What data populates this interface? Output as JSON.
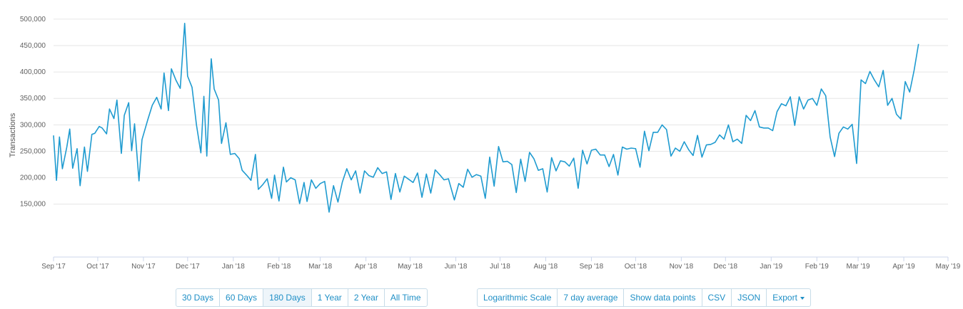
{
  "chart_data": {
    "type": "line",
    "ylabel": "Transactions",
    "ylim": [
      50000,
      520000
    ],
    "y_ticks": [
      150000,
      200000,
      250000,
      300000,
      350000,
      400000,
      450000,
      500000
    ],
    "y_tick_labels": [
      "150,000",
      "200,000",
      "250,000",
      "300,000",
      "350,000",
      "400,000",
      "450,000",
      "500,000"
    ],
    "x_ticks": [
      {
        "label": "Sep '17",
        "date": "2017-09-01"
      },
      {
        "label": "Oct '17",
        "date": "2017-10-01"
      },
      {
        "label": "Nov '17",
        "date": "2017-11-01"
      },
      {
        "label": "Dec '17",
        "date": "2017-12-01"
      },
      {
        "label": "Jan '18",
        "date": "2018-01-01"
      },
      {
        "label": "Feb '18",
        "date": "2018-02-01"
      },
      {
        "label": "Mar '18",
        "date": "2018-03-01"
      },
      {
        "label": "Apr '18",
        "date": "2018-04-01"
      },
      {
        "label": "May '18",
        "date": "2018-05-01"
      },
      {
        "label": "Jun '18",
        "date": "2018-06-01"
      },
      {
        "label": "Jul '18",
        "date": "2018-07-01"
      },
      {
        "label": "Aug '18",
        "date": "2018-08-01"
      },
      {
        "label": "Sep '18",
        "date": "2018-09-01"
      },
      {
        "label": "Oct '18",
        "date": "2018-10-01"
      },
      {
        "label": "Nov '18",
        "date": "2018-11-01"
      },
      {
        "label": "Dec '18",
        "date": "2018-12-01"
      },
      {
        "label": "Jan '19",
        "date": "2019-01-01"
      },
      {
        "label": "Feb '19",
        "date": "2019-02-01"
      },
      {
        "label": "Mar '19",
        "date": "2019-03-01"
      },
      {
        "label": "Apr '19",
        "date": "2019-04-01"
      },
      {
        "label": "May '19",
        "date": "2019-05-01"
      }
    ],
    "grid": true,
    "line_color": "#1f9bd0",
    "series": [
      {
        "points": [
          [
            "2017-09-01",
            280000
          ],
          [
            "2017-09-03",
            195000
          ],
          [
            "2017-09-05",
            277000
          ],
          [
            "2017-09-07",
            217000
          ],
          [
            "2017-09-10",
            258000
          ],
          [
            "2017-09-12",
            292000
          ],
          [
            "2017-09-14",
            218000
          ],
          [
            "2017-09-17",
            255000
          ],
          [
            "2017-09-19",
            185000
          ],
          [
            "2017-09-22",
            258000
          ],
          [
            "2017-09-24",
            212000
          ],
          [
            "2017-09-27",
            282000
          ],
          [
            "2017-09-29",
            284000
          ],
          [
            "2017-10-02",
            297000
          ],
          [
            "2017-10-04",
            294000
          ],
          [
            "2017-10-07",
            283000
          ],
          [
            "2017-10-09",
            330000
          ],
          [
            "2017-10-12",
            312000
          ],
          [
            "2017-10-14",
            347000
          ],
          [
            "2017-10-17",
            246000
          ],
          [
            "2017-10-19",
            318000
          ],
          [
            "2017-10-22",
            342000
          ],
          [
            "2017-10-24",
            251000
          ],
          [
            "2017-10-26",
            302000
          ],
          [
            "2017-10-29",
            194000
          ],
          [
            "2017-10-31",
            272000
          ],
          [
            "2017-11-04",
            310000
          ],
          [
            "2017-11-07",
            337000
          ],
          [
            "2017-11-10",
            352000
          ],
          [
            "2017-11-13",
            330000
          ],
          [
            "2017-11-15",
            398000
          ],
          [
            "2017-11-18",
            327000
          ],
          [
            "2017-11-20",
            406000
          ],
          [
            "2017-11-23",
            385000
          ],
          [
            "2017-11-26",
            369000
          ],
          [
            "2017-11-29",
            492000
          ],
          [
            "2017-12-01",
            392000
          ],
          [
            "2017-12-04",
            371000
          ],
          [
            "2017-12-07",
            300000
          ],
          [
            "2017-12-10",
            247000
          ],
          [
            "2017-12-12",
            354000
          ],
          [
            "2017-12-14",
            241000
          ],
          [
            "2017-12-17",
            425000
          ],
          [
            "2017-12-19",
            368000
          ],
          [
            "2017-12-22",
            347000
          ],
          [
            "2017-12-24",
            265000
          ],
          [
            "2017-12-27",
            304000
          ],
          [
            "2017-12-30",
            244000
          ],
          [
            "2018-01-02",
            246000
          ],
          [
            "2018-01-05",
            236000
          ],
          [
            "2018-01-07",
            214000
          ],
          [
            "2018-01-10",
            205000
          ],
          [
            "2018-01-13",
            195000
          ],
          [
            "2018-01-16",
            244000
          ],
          [
            "2018-01-18",
            178000
          ],
          [
            "2018-01-21",
            187000
          ],
          [
            "2018-01-24",
            198000
          ],
          [
            "2018-01-27",
            161000
          ],
          [
            "2018-01-29",
            205000
          ],
          [
            "2018-02-01",
            156000
          ],
          [
            "2018-02-04",
            220000
          ],
          [
            "2018-02-06",
            192000
          ],
          [
            "2018-02-09",
            200000
          ],
          [
            "2018-02-12",
            196000
          ],
          [
            "2018-02-15",
            151000
          ],
          [
            "2018-02-18",
            191000
          ],
          [
            "2018-02-20",
            155000
          ],
          [
            "2018-02-23",
            196000
          ],
          [
            "2018-02-26",
            180000
          ],
          [
            "2018-03-01",
            189000
          ],
          [
            "2018-03-04",
            193000
          ],
          [
            "2018-03-07",
            135000
          ],
          [
            "2018-03-10",
            185000
          ],
          [
            "2018-03-13",
            154000
          ],
          [
            "2018-03-16",
            192000
          ],
          [
            "2018-03-19",
            217000
          ],
          [
            "2018-03-22",
            196000
          ],
          [
            "2018-03-25",
            213000
          ],
          [
            "2018-03-28",
            171000
          ],
          [
            "2018-03-31",
            213000
          ],
          [
            "2018-04-03",
            204000
          ],
          [
            "2018-04-06",
            201000
          ],
          [
            "2018-04-09",
            219000
          ],
          [
            "2018-04-12",
            208000
          ],
          [
            "2018-04-15",
            211000
          ],
          [
            "2018-04-18",
            159000
          ],
          [
            "2018-04-21",
            208000
          ],
          [
            "2018-04-24",
            173000
          ],
          [
            "2018-04-27",
            203000
          ],
          [
            "2018-04-30",
            197000
          ],
          [
            "2018-05-03",
            191000
          ],
          [
            "2018-05-06",
            209000
          ],
          [
            "2018-05-09",
            163000
          ],
          [
            "2018-05-12",
            207000
          ],
          [
            "2018-05-15",
            171000
          ],
          [
            "2018-05-18",
            215000
          ],
          [
            "2018-05-21",
            206000
          ],
          [
            "2018-05-24",
            196000
          ],
          [
            "2018-05-27",
            198000
          ],
          [
            "2018-05-31",
            158000
          ],
          [
            "2018-06-03",
            189000
          ],
          [
            "2018-06-06",
            182000
          ],
          [
            "2018-06-09",
            216000
          ],
          [
            "2018-06-12",
            201000
          ],
          [
            "2018-06-15",
            206000
          ],
          [
            "2018-06-18",
            203000
          ],
          [
            "2018-06-21",
            161000
          ],
          [
            "2018-06-24",
            239000
          ],
          [
            "2018-06-27",
            184000
          ],
          [
            "2018-06-30",
            259000
          ],
          [
            "2018-07-03",
            230000
          ],
          [
            "2018-07-06",
            231000
          ],
          [
            "2018-07-09",
            225000
          ],
          [
            "2018-07-12",
            172000
          ],
          [
            "2018-07-15",
            235000
          ],
          [
            "2018-07-18",
            193000
          ],
          [
            "2018-07-21",
            248000
          ],
          [
            "2018-07-24",
            236000
          ],
          [
            "2018-07-27",
            214000
          ],
          [
            "2018-07-30",
            217000
          ],
          [
            "2018-08-02",
            173000
          ],
          [
            "2018-08-05",
            238000
          ],
          [
            "2018-08-08",
            213000
          ],
          [
            "2018-08-11",
            232000
          ],
          [
            "2018-08-14",
            230000
          ],
          [
            "2018-08-17",
            222000
          ],
          [
            "2018-08-20",
            237000
          ],
          [
            "2018-08-23",
            180000
          ],
          [
            "2018-08-26",
            252000
          ],
          [
            "2018-08-29",
            226000
          ],
          [
            "2018-09-01",
            252000
          ],
          [
            "2018-09-04",
            254000
          ],
          [
            "2018-09-07",
            243000
          ],
          [
            "2018-09-10",
            243000
          ],
          [
            "2018-09-13",
            221000
          ],
          [
            "2018-09-16",
            244000
          ],
          [
            "2018-09-19",
            205000
          ],
          [
            "2018-09-22",
            258000
          ],
          [
            "2018-09-25",
            254000
          ],
          [
            "2018-09-28",
            256000
          ],
          [
            "2018-10-01",
            255000
          ],
          [
            "2018-10-04",
            220000
          ],
          [
            "2018-10-07",
            288000
          ],
          [
            "2018-10-10",
            251000
          ],
          [
            "2018-10-13",
            286000
          ],
          [
            "2018-10-16",
            286000
          ],
          [
            "2018-10-19",
            300000
          ],
          [
            "2018-10-22",
            291000
          ],
          [
            "2018-10-25",
            241000
          ],
          [
            "2018-10-28",
            256000
          ],
          [
            "2018-10-31",
            250000
          ],
          [
            "2018-11-03",
            268000
          ],
          [
            "2018-11-06",
            253000
          ],
          [
            "2018-11-09",
            242000
          ],
          [
            "2018-11-12",
            280000
          ],
          [
            "2018-11-15",
            239000
          ],
          [
            "2018-11-18",
            262000
          ],
          [
            "2018-11-21",
            263000
          ],
          [
            "2018-11-24",
            267000
          ],
          [
            "2018-11-27",
            281000
          ],
          [
            "2018-11-30",
            273000
          ],
          [
            "2018-12-03",
            300000
          ],
          [
            "2018-12-06",
            268000
          ],
          [
            "2018-12-09",
            273000
          ],
          [
            "2018-12-12",
            265000
          ],
          [
            "2018-12-15",
            318000
          ],
          [
            "2018-12-18",
            308000
          ],
          [
            "2018-12-21",
            327000
          ],
          [
            "2018-12-24",
            296000
          ],
          [
            "2018-12-27",
            294000
          ],
          [
            "2018-12-30",
            294000
          ],
          [
            "2019-01-02",
            289000
          ],
          [
            "2019-01-05",
            325000
          ],
          [
            "2019-01-08",
            340000
          ],
          [
            "2019-01-11",
            336000
          ],
          [
            "2019-01-14",
            353000
          ],
          [
            "2019-01-17",
            299000
          ],
          [
            "2019-01-20",
            353000
          ],
          [
            "2019-01-23",
            330000
          ],
          [
            "2019-01-26",
            347000
          ],
          [
            "2019-01-29",
            350000
          ],
          [
            "2019-02-01",
            337000
          ],
          [
            "2019-02-04",
            368000
          ],
          [
            "2019-02-07",
            355000
          ],
          [
            "2019-02-10",
            277000
          ],
          [
            "2019-02-13",
            240000
          ],
          [
            "2019-02-16",
            284000
          ],
          [
            "2019-02-19",
            296000
          ],
          [
            "2019-02-22",
            292000
          ],
          [
            "2019-02-25",
            301000
          ],
          [
            "2019-02-28",
            227000
          ],
          [
            "2019-03-03",
            385000
          ],
          [
            "2019-03-06",
            378000
          ],
          [
            "2019-03-09",
            401000
          ],
          [
            "2019-03-12",
            385000
          ],
          [
            "2019-03-15",
            372000
          ],
          [
            "2019-03-18",
            403000
          ],
          [
            "2019-03-21",
            337000
          ],
          [
            "2019-03-24",
            350000
          ],
          [
            "2019-03-27",
            320000
          ],
          [
            "2019-03-30",
            311000
          ],
          [
            "2019-04-02",
            382000
          ],
          [
            "2019-04-05",
            362000
          ],
          [
            "2019-04-08",
            403000
          ],
          [
            "2019-04-11",
            453000
          ]
        ]
      }
    ]
  },
  "range_buttons": [
    "30 Days",
    "60 Days",
    "180 Days",
    "1 Year",
    "2 Year",
    "All Time"
  ],
  "option_buttons": {
    "log_scale": "Logarithmic Scale",
    "avg": "7 day average",
    "points": "Show data points",
    "csv": "CSV",
    "json": "JSON",
    "export": "Export"
  }
}
